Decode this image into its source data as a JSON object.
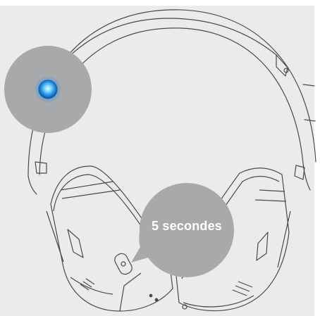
{
  "callout": {
    "duration_label": "5 secondes"
  },
  "colors": {
    "background": "#ebebeb",
    "line": "#4a4a4a",
    "bubble": "#a8a9ab",
    "led_glow": "#27a9ef",
    "led_core": "#9fe2ff",
    "text": "#ffffff"
  },
  "icons": {
    "led": "blue-led-indicator-icon",
    "headphones": "over-ear-headphones-icon"
  }
}
